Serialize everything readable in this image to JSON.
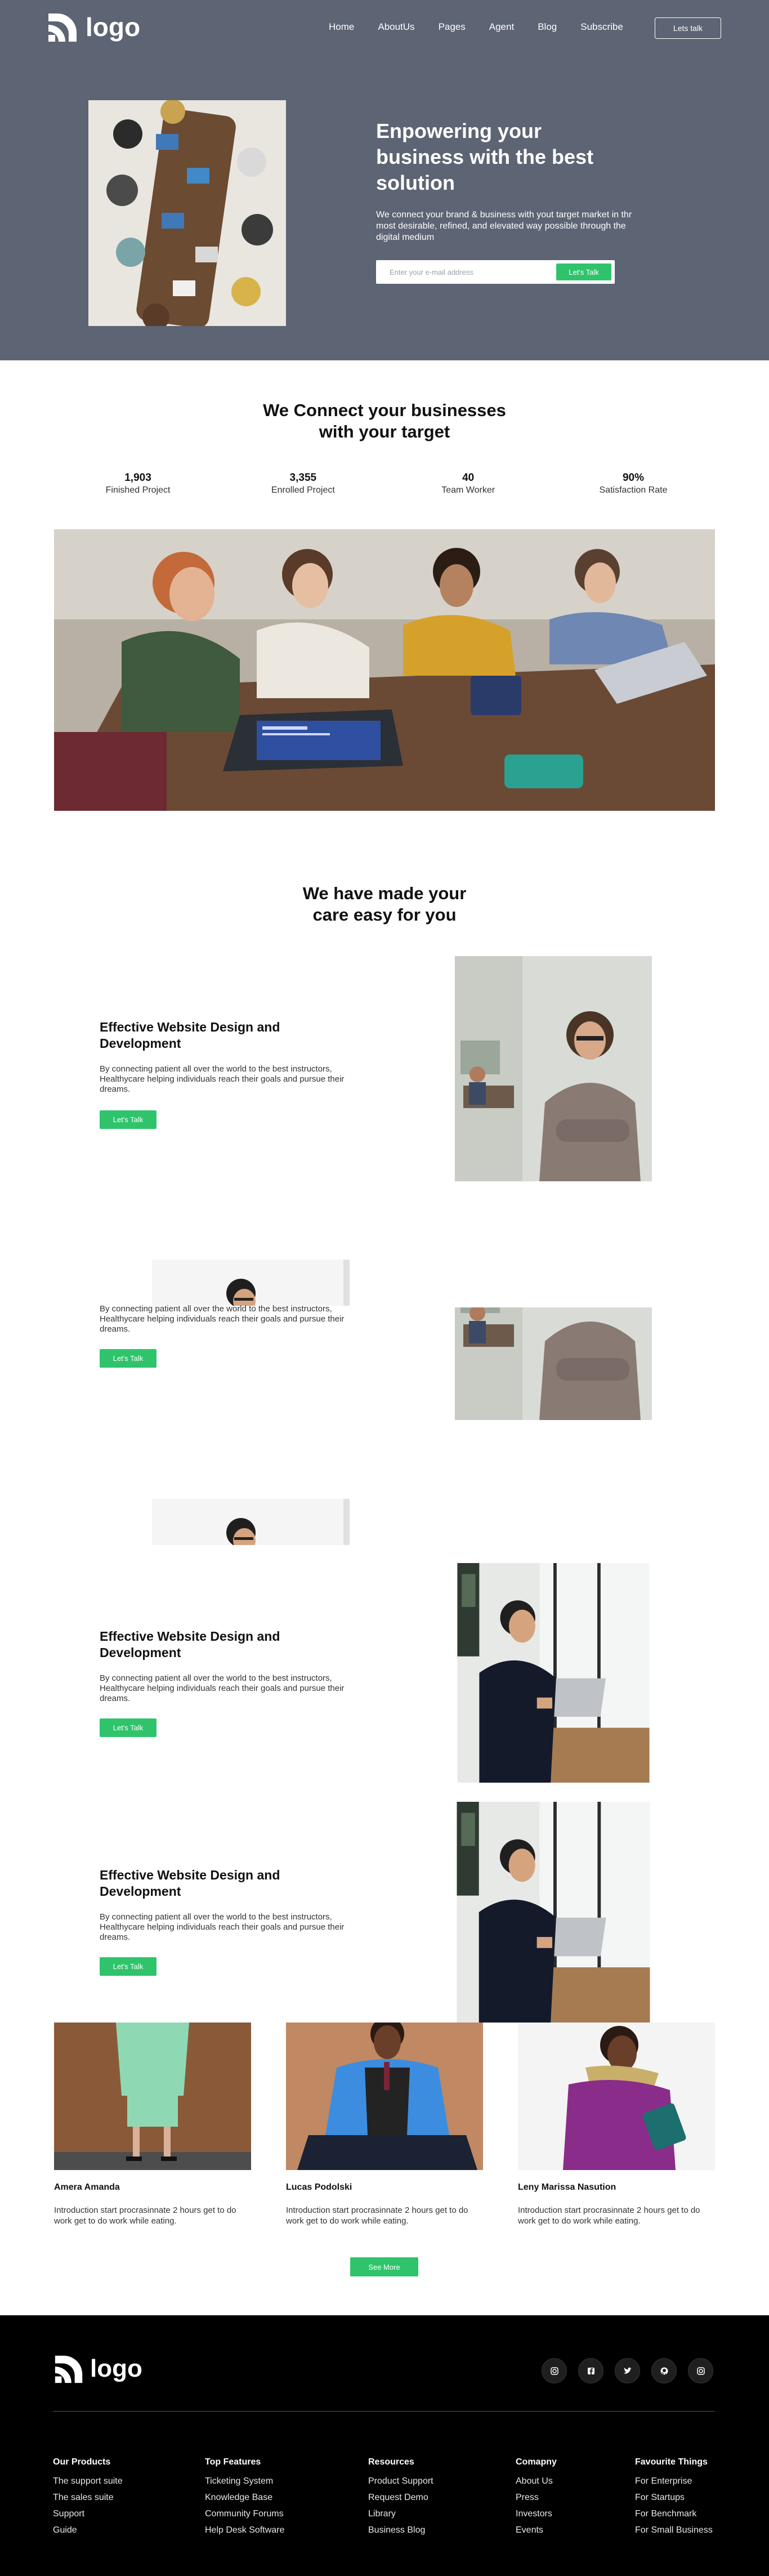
{
  "nav": {
    "logo_text": "logo",
    "links": [
      "Home",
      "AboutUs",
      "Pages",
      "Agent",
      "Blog",
      "Subscribe"
    ],
    "cta_label": "Lets talk"
  },
  "hero": {
    "title": "Enpowering your business with the best solution",
    "subtitle": "We connect your brand & business with yout target market in thr most desirable, refined, and elevated way possible through the digital medium",
    "email_placeholder": "Enter your e-mail address",
    "button_label": "Let's Talk"
  },
  "connect": {
    "title_line1": "We Connect your businesses",
    "title_line2": "with your target",
    "stats": [
      {
        "value": "1,903",
        "label": "Finished Project"
      },
      {
        "value": "3,355",
        "label": "Enrolled Project"
      },
      {
        "value": "40",
        "label": "Team Worker"
      },
      {
        "value": "90%",
        "label": "Satisfaction Rate"
      }
    ]
  },
  "care": {
    "title_line1": "We have made your",
    "title_line2": "care easy for you"
  },
  "features": [
    {
      "heading": "Effective Website Design and Development",
      "text": "By connecting patient all over the world to the best instructors, Healthycare helping individuals reach their goals and pursue their dreams.",
      "button": "Let's Talk"
    },
    {
      "heading": "",
      "text": "By connecting patient all over the world to the best instructors, Healthycare helping individuals reach their goals and pursue their dreams.",
      "button": "Let's Talk"
    },
    {
      "heading": "Effective Website Design and Development",
      "text": "By connecting patient all over the world to the best instructors, Healthycare helping individuals reach their goals and pursue their dreams.",
      "button": "Let's Talk"
    },
    {
      "heading": "Effective Website Design and Development",
      "text": "By connecting patient all over the world to the best instructors, Healthycare helping individuals reach their goals and pursue their dreams.",
      "button": "Let's Talk"
    }
  ],
  "team": [
    {
      "name": "Amera Amanda",
      "desc": "Introduction start procrasinnate 2 hours get to do work get to do work while eating."
    },
    {
      "name": "Lucas Podolski",
      "desc": "Introduction start procrasinnate 2 hours get to do work get to do work while eating."
    },
    {
      "name": "Leny Marissa Nasution",
      "desc": "Introduction start procrasinnate 2 hours get to do work get to do work while eating."
    }
  ],
  "see_more_label": "See More",
  "footer": {
    "logo_text": "logo",
    "social_icons": [
      "instagram-icon",
      "facebook-icon",
      "twitter-icon",
      "github-icon",
      "instagram-icon"
    ],
    "columns": [
      {
        "title": "Our Products",
        "links": [
          "The support suite",
          "The sales suite",
          "Support",
          "Guide"
        ]
      },
      {
        "title": "Top Features",
        "links": [
          "Ticketing System",
          "Knowledge Base",
          "Community Forums",
          "Help Desk Software"
        ]
      },
      {
        "title": "Resources",
        "links": [
          "Product Support",
          "Request Demo",
          "Library",
          "Business Blog"
        ]
      },
      {
        "title": "Comapny",
        "links": [
          "About Us",
          "Press",
          "Investors",
          "Events"
        ]
      },
      {
        "title": "Favourite Things",
        "links": [
          "For Enterprise",
          "For Startups",
          "For Benchmark",
          "For Small Business"
        ]
      }
    ]
  },
  "colors": {
    "hero_bg": "#5d6473",
    "accent": "#2fc46b",
    "footer_bg": "#000000"
  }
}
